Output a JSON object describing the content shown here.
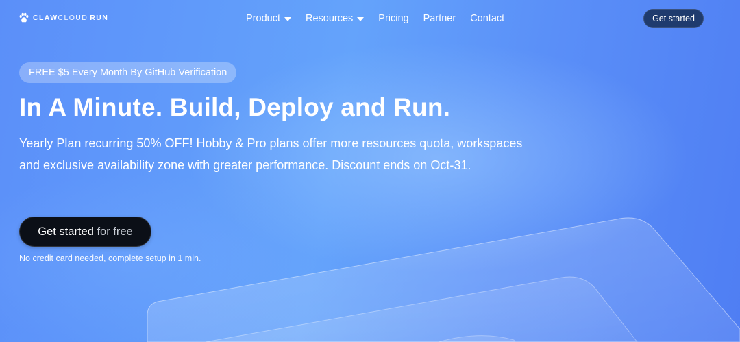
{
  "brand": {
    "word1": "CLAW",
    "word2": "CLOUD",
    "word3": "RUN",
    "icon": "paw-icon"
  },
  "nav": {
    "items": [
      {
        "label": "Product",
        "has_dropdown": true
      },
      {
        "label": "Resources",
        "has_dropdown": true
      },
      {
        "label": "Pricing",
        "has_dropdown": false
      },
      {
        "label": "Partner",
        "has_dropdown": false
      },
      {
        "label": "Contact",
        "has_dropdown": false
      }
    ],
    "cta_label": "Get started"
  },
  "hero": {
    "promo": "FREE $5 Every Month By GitHub Verification",
    "title": "In A Minute. Build, Deploy and Run.",
    "description": "Yearly Plan recurring 50% OFF! Hobby & Pro plans offer more resources quota, workspaces and exclusive availability zone with greater performance. Discount ends on Oct-31.",
    "cta_main": "Get started",
    "cta_fade": " for free",
    "note": "No credit card needed, complete setup in 1 min."
  },
  "colors": {
    "background": "#5a8cfb",
    "header_button": "#1f3b6e",
    "primary_button": "#0b0f17"
  }
}
